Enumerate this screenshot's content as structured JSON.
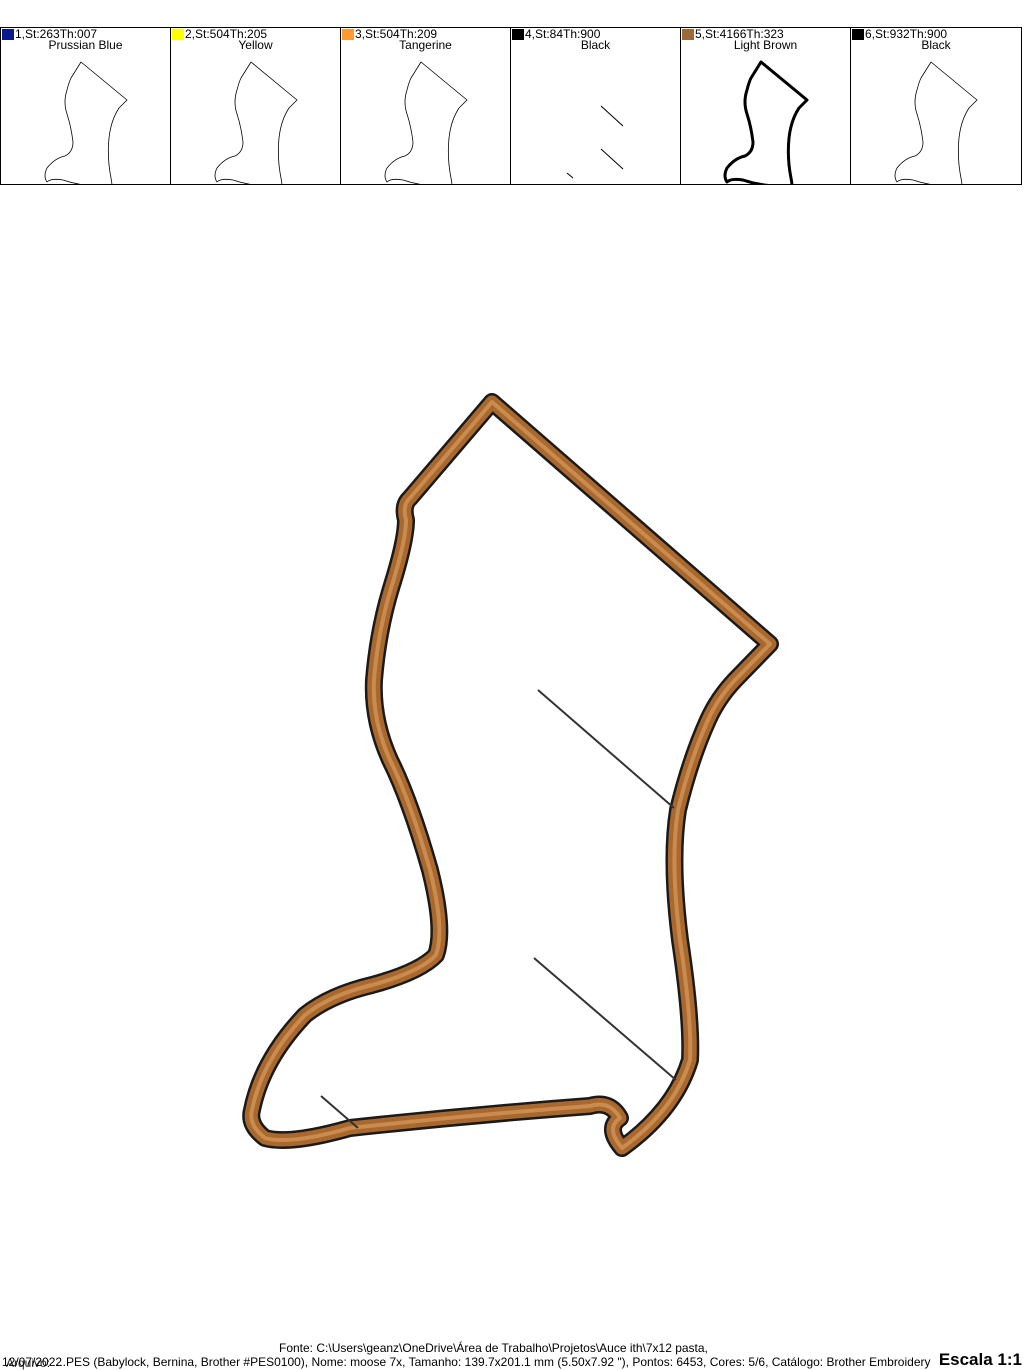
{
  "threads": [
    {
      "info": "1,St:263Th:007",
      "name": "Prussian Blue",
      "color": "#0a1a8c",
      "thumb": "outline"
    },
    {
      "info": "2,St:504Th:205",
      "name": "Yellow",
      "color": "#ffff00",
      "thumb": "outline"
    },
    {
      "info": "3,St:504Th:209",
      "name": "Tangerine",
      "color": "#ff9933",
      "thumb": "outline"
    },
    {
      "info": "4,St:84Th:900",
      "name": "Black",
      "color": "#000000",
      "thumb": "lines"
    },
    {
      "info": "5,St:4166Th:323",
      "name": "Light Brown",
      "color": "#9b6a38",
      "thumb": "thick-outline"
    },
    {
      "info": "6,St:932Th:900",
      "name": "Black",
      "color": "#000000",
      "thumb": "outline"
    }
  ],
  "design": {
    "outline_color": "#a8682e",
    "outline_highlight": "#d89a5e",
    "edge_color": "#1a1a1a"
  },
  "footer": {
    "source_line": "Fonte: C:\\Users\\geanz\\OneDrive\\Área de Trabalho\\Projetos\\Auce ith\\7x12 pasta,",
    "date": "12/07/2022",
    "file_prefix": "Arquivo:",
    "details_line": "...PES (Babylock, Bernina, Brother #PES0100), Nome: moose 7x, Tamanho: 139.7x201.1 mm (5.50x7.92 \"), Pontos: 6453, Cores: 5/6, Catálogo: Brother Embroidery",
    "scale": "Escala 1:1"
  }
}
